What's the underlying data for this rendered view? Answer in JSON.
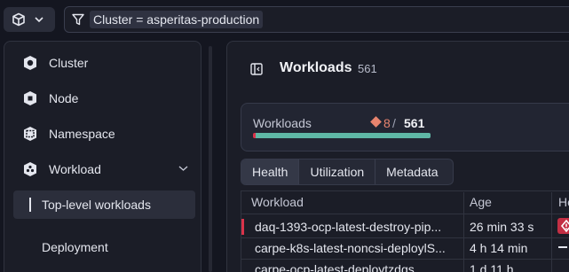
{
  "filter": {
    "text": "Cluster = asperitas-production"
  },
  "sidebar": {
    "items": [
      {
        "label": "Cluster",
        "icon": "cluster-icon"
      },
      {
        "label": "Node",
        "icon": "node-icon"
      },
      {
        "label": "Namespace",
        "icon": "namespace-icon"
      },
      {
        "label": "Workload",
        "icon": "workload-icon",
        "expanded": true
      }
    ],
    "sub_items": [
      {
        "label": "Top-level workloads",
        "active": true
      },
      {
        "label": "Deployment"
      }
    ]
  },
  "main": {
    "title": "Workloads",
    "count": "561",
    "summary": {
      "label": "Workloads",
      "issues": "8",
      "separator": "/",
      "total": "561",
      "issue_fraction": 0.014
    },
    "tabs": [
      {
        "label": "Health",
        "active": true
      },
      {
        "label": "Utilization"
      },
      {
        "label": "Metadata"
      }
    ],
    "table": {
      "columns": [
        "Workload",
        "Age",
        "He"
      ],
      "rows": [
        {
          "workload": "daq-1393-ocp-latest-destroy-pip...",
          "age": "26 min 33 s",
          "status": "critical"
        },
        {
          "workload": "carpe-k8s-latest-noncsi-deploylS...",
          "age": "4 h 14 min",
          "status": "none"
        },
        {
          "workload": "carpe-ocp-latest-deploytzdqs...",
          "age": "1 d 11 h",
          "status": ""
        }
      ]
    }
  },
  "colors": {
    "background": "#141620",
    "panel": "#1b1d27",
    "critical": "#d9334a",
    "healthy": "#5fb8a6",
    "warning": "#e8846e"
  }
}
